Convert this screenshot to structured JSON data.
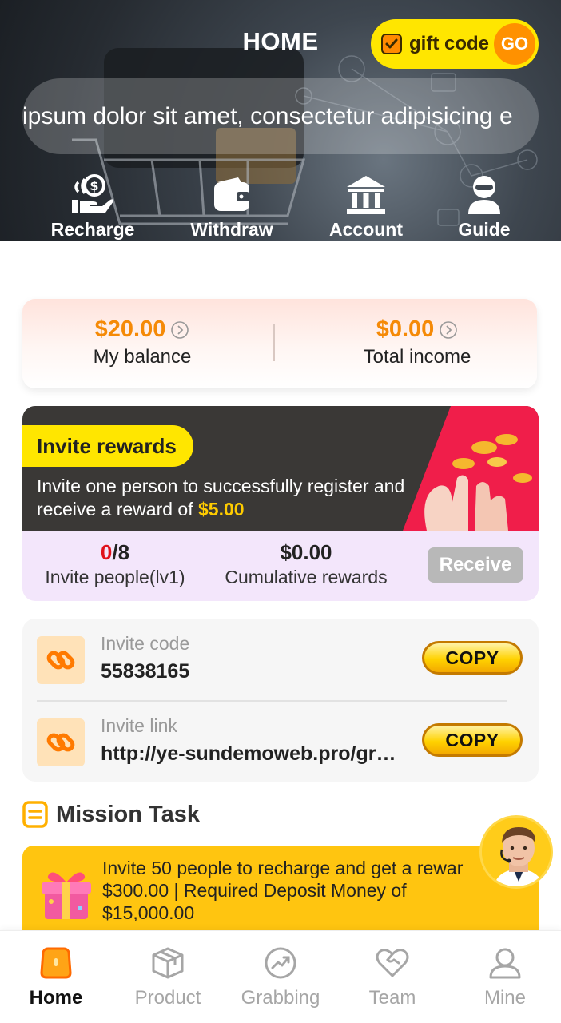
{
  "header": {
    "title": "HOME",
    "gift_label": "gift code",
    "go_label": "GO"
  },
  "marquee": {
    "text": "ipsum dolor sit amet, consectetur adipisicing e"
  },
  "quick_actions": [
    {
      "label": "Recharge",
      "icon": "hand-coins-icon"
    },
    {
      "label": "Withdraw",
      "icon": "wallet-icon"
    },
    {
      "label": "Account",
      "icon": "bank-icon"
    },
    {
      "label": "Guide",
      "icon": "person-icon"
    }
  ],
  "balance": {
    "my_balance_amount": "$20.00",
    "my_balance_label": "My balance",
    "total_income_amount": "$0.00",
    "total_income_label": "Total income"
  },
  "invite": {
    "title": "Invite rewards",
    "desc_prefix": "Invite one person to successfully register and receive a reward of ",
    "reward_amount": "$5.00",
    "people_count": "0",
    "people_total": "/8",
    "people_label": "Invite people(lv1)",
    "cumulative_amount": "$0.00",
    "cumulative_label": "Cumulative rewards",
    "receive_label": "Receive"
  },
  "invite_code": {
    "code_label": "Invite code",
    "code_value": "55838165",
    "link_label": "Invite link",
    "link_value": "http://ye-sundemoweb.pro/gr…",
    "copy_label": "COPY"
  },
  "mission": {
    "title": "Mission Task",
    "line1": "Invite 50 people to recharge and get a rewar",
    "line2": "$300.00 | Required Deposit Money of",
    "line3": "$15,000.00"
  },
  "bottom_nav": [
    {
      "label": "Home",
      "active": true
    },
    {
      "label": "Product",
      "active": false
    },
    {
      "label": "Grabbing",
      "active": false
    },
    {
      "label": "Team",
      "active": false
    },
    {
      "label": "Mine",
      "active": false
    }
  ],
  "colors": {
    "accent_orange": "#f58a07",
    "accent_yellow": "#ffe600",
    "mission_yellow": "#ffc510",
    "invite_red": "#e0121c"
  }
}
